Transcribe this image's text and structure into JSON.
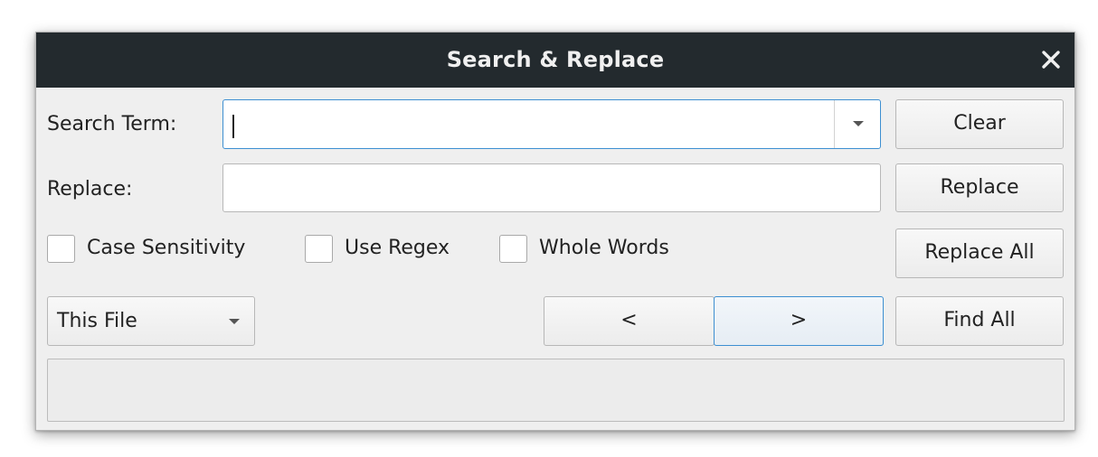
{
  "dialog": {
    "title": "Search & Replace",
    "close_icon": "close-icon"
  },
  "search": {
    "label": "Search Term:",
    "value": "",
    "dropdown_icon": "chevron-down-icon"
  },
  "replace": {
    "label": "Replace:",
    "value": ""
  },
  "buttons": {
    "clear": "Clear",
    "replace": "Replace",
    "replace_all": "Replace All",
    "prev": "<",
    "next": ">",
    "find_all": "Find All"
  },
  "options": [
    {
      "label": "Case Sensitivity",
      "checked": false
    },
    {
      "label": "Use Regex",
      "checked": false
    },
    {
      "label": "Whole Words",
      "checked": false
    }
  ],
  "scope": {
    "selected": "This File"
  },
  "status": {
    "text": ""
  },
  "colors": {
    "titlebar": "#232a2e",
    "focus_accent": "#3d8fd1",
    "dialog_bg": "#efefef"
  }
}
